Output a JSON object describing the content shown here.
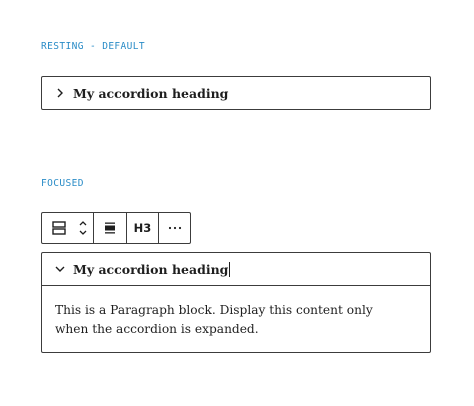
{
  "states": {
    "resting_label": "RESTING - DEFAULT",
    "focused_label": "FOCUSED"
  },
  "accordion_resting": {
    "heading": "My accordion heading",
    "icon": "chevron-right-icon"
  },
  "toolbar": {
    "block_icon": "accordion-block-icon",
    "move_icon": "move-up-down-icon",
    "align_icon": "align-icon",
    "heading_level": "H3",
    "more_icon": "more-options-icon"
  },
  "accordion_focused": {
    "heading": "My accordion heading",
    "icon": "chevron-down-icon",
    "body": "This is a Paragraph block. Display this content only when the accordion is expanded."
  },
  "colors": {
    "label_blue": "#2a8cc7",
    "border": "#3c3c3c",
    "text": "#1e1e1e"
  }
}
